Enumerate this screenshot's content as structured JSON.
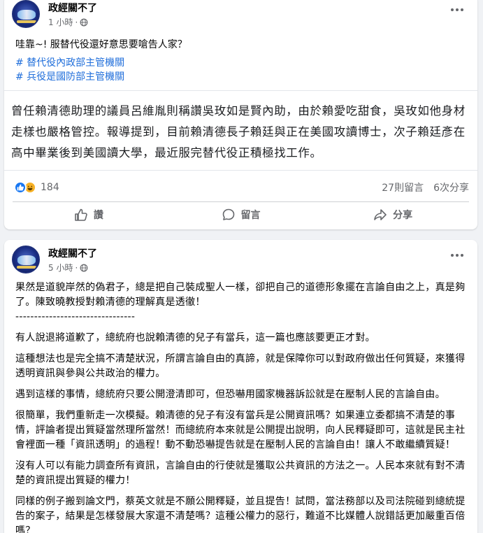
{
  "posts": [
    {
      "author": "政經關不了",
      "time": "1 小時",
      "caption": "哇靠~! 服替代役還好意思要嗆告人家？",
      "hashtags": [
        "# 替代役內政部主管機關",
        "# 兵役是國防部主管機關"
      ],
      "preview_text": "曾任賴清德助理的議員呂維胤則稱讚吳玫如是賢內助，由於賴愛吃甜食，吳玫如他身材走樣也嚴格管控。報導提到，目前賴清德長子賴廷與正在美國攻讀博士，次子賴廷彥在高中畢業後到美國讀大學，最近服完替代役正積極找工作。",
      "reaction_count": "184",
      "comments": "27則留言",
      "shares": "6次分享",
      "actions": {
        "like": "讚",
        "comment": "留言",
        "share": "分享"
      }
    },
    {
      "author": "政經關不了",
      "time": "5 小時",
      "paragraphs": [
        "果然是道貌岸然的偽君子，總是把自己裝成聖人一樣，卻把自己的道德形象擺在言論自由之上，真是夠了。陳致曉教授對賴清德的理解真是透徹！",
        "--------------------------------",
        "有人說退將道歉了，總統府也說賴清德的兒子有當兵，這一篇也應該要更正才對。",
        "這種想法也是完全搞不清楚狀況，所謂言論自由的真諦，就是保障你可以對政府做出任何質疑，來獲得透明資訊與參與公共政治的權力。",
        "遇到這樣的事情，總統府只要公開澄清即可，但恐嚇用國家機器訴訟就是在壓制人民的言論自由。",
        "很簡單，我們重新走一次模擬。賴清德的兒子有沒有當兵是公開資訊嗎？如果連立委都搞不清楚的事情，評論者提出質疑當然理所當然！而總統府本來就是公開提出說明，向人民釋疑即可，這就是民主社會裡面一種「資訊透明」的過程！動不動恐嚇提告就是在壓制人民的言論自由！讓人不敢繼續質疑！",
        "沒有人可以有能力調查所有資訊，言論自由的行使就是獲取公共資訊的方法之一。人民本來就有對不清楚的資訊提出質疑的權力！",
        "同樣的例子搬到論文門，蔡英文就是不願公開釋疑，並且提告！試問，當法務部以及司法院碰到總統提告的案子，結果是怎樣發展大家還不清楚嗎？這種公權力的惡行，難道不比媒體人說錯話更加嚴重百倍嗎？"
      ]
    }
  ]
}
